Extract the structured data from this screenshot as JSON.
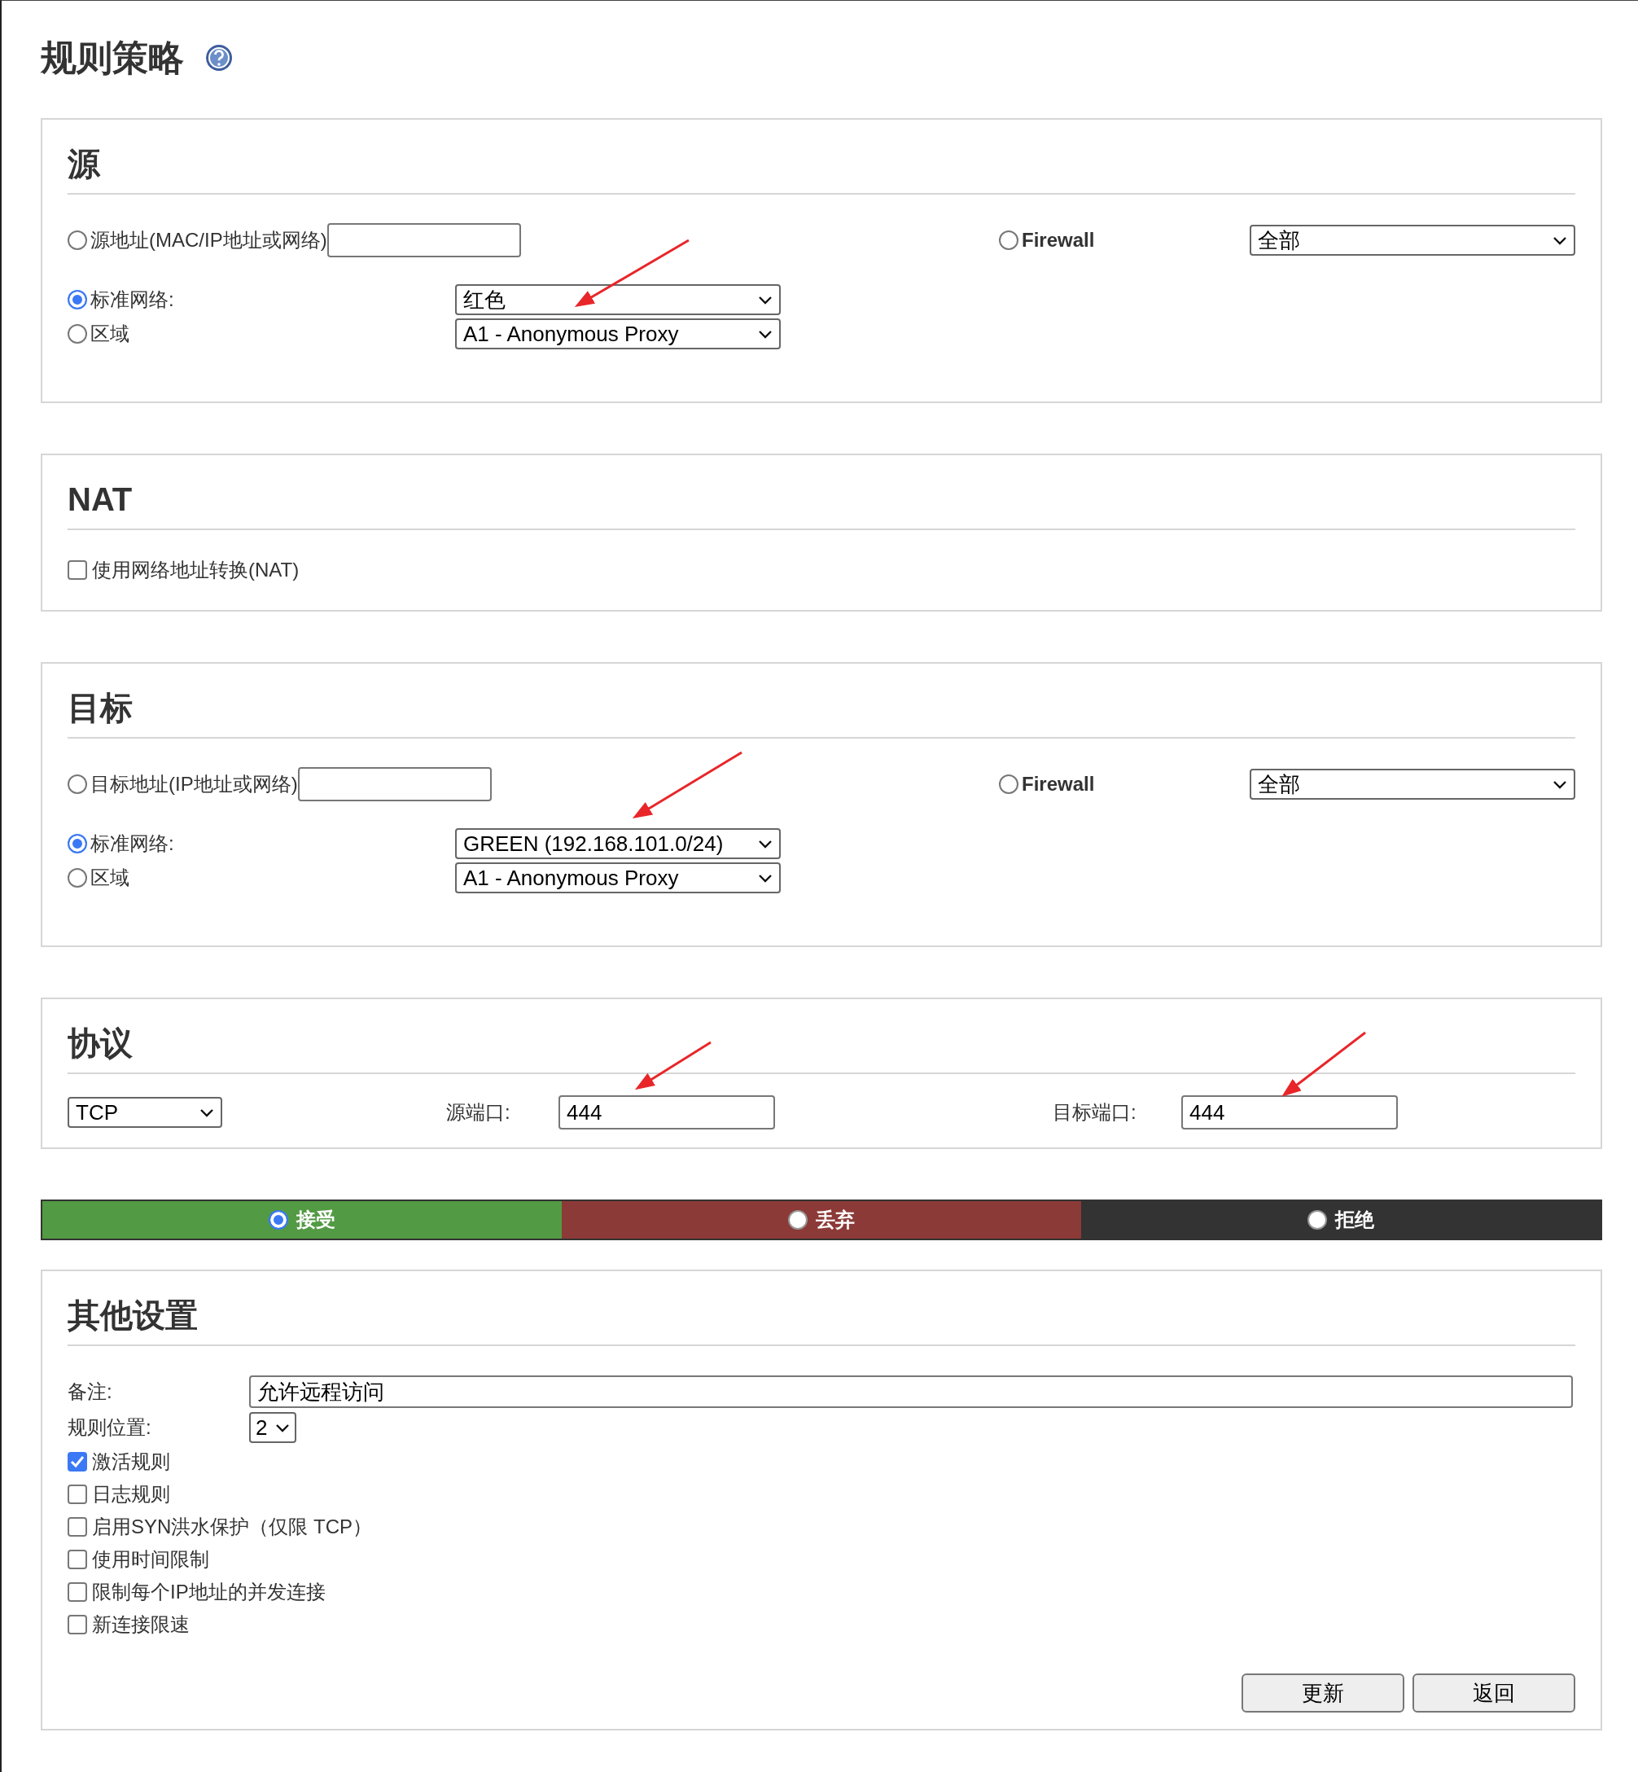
{
  "title": "规则策略",
  "source": {
    "legend": "源",
    "address": {
      "label": "源地址(MAC/IP地址或网络)",
      "selected": false
    },
    "firewall": {
      "label": "Firewall",
      "selected": false,
      "value": "全部"
    },
    "standard": {
      "label": "标准网络:",
      "selected": true,
      "value": "红色"
    },
    "zone": {
      "label": "区域",
      "selected": false,
      "value": "A1 - Anonymous Proxy"
    }
  },
  "nat": {
    "legend": "NAT",
    "use_nat": {
      "label": "使用网络地址转换(NAT)",
      "checked": false
    }
  },
  "target": {
    "legend": "目标",
    "address": {
      "label": "目标地址(IP地址或网络)",
      "selected": false
    },
    "firewall": {
      "label": "Firewall",
      "selected": false,
      "value": "全部"
    },
    "standard": {
      "label": "标准网络:",
      "selected": true,
      "value": "GREEN (192.168.101.0/24)"
    },
    "zone": {
      "label": "区域",
      "selected": false,
      "value": "A1 - Anonymous Proxy"
    }
  },
  "protocol": {
    "legend": "协议",
    "protocol": "TCP",
    "source_port": {
      "label": "源端口:",
      "value": "444"
    },
    "target_port": {
      "label": "目标端口:",
      "value": "444"
    }
  },
  "actions": [
    {
      "label": "接受",
      "selected": true,
      "color": "#529a43"
    },
    {
      "label": "丢弃",
      "selected": false,
      "color": "#8c3a37"
    },
    {
      "label": "拒绝",
      "selected": false,
      "color": "#333333"
    }
  ],
  "other": {
    "legend": "其他设置",
    "remark": {
      "label": "备注:",
      "value": "允许远程访问"
    },
    "position": {
      "label": "规则位置:",
      "value": "2"
    },
    "options": [
      {
        "label": "激活规则",
        "checked": true
      },
      {
        "label": "日志规则",
        "checked": false
      },
      {
        "label": "启用SYN洪水保护（仅限 TCP）",
        "checked": false
      },
      {
        "label": "使用时间限制",
        "checked": false
      },
      {
        "label": "限制每个IP地址的并发连接",
        "checked": false
      },
      {
        "label": "新连接限速",
        "checked": false
      }
    ],
    "buttons": [
      "更新",
      "返回"
    ]
  }
}
